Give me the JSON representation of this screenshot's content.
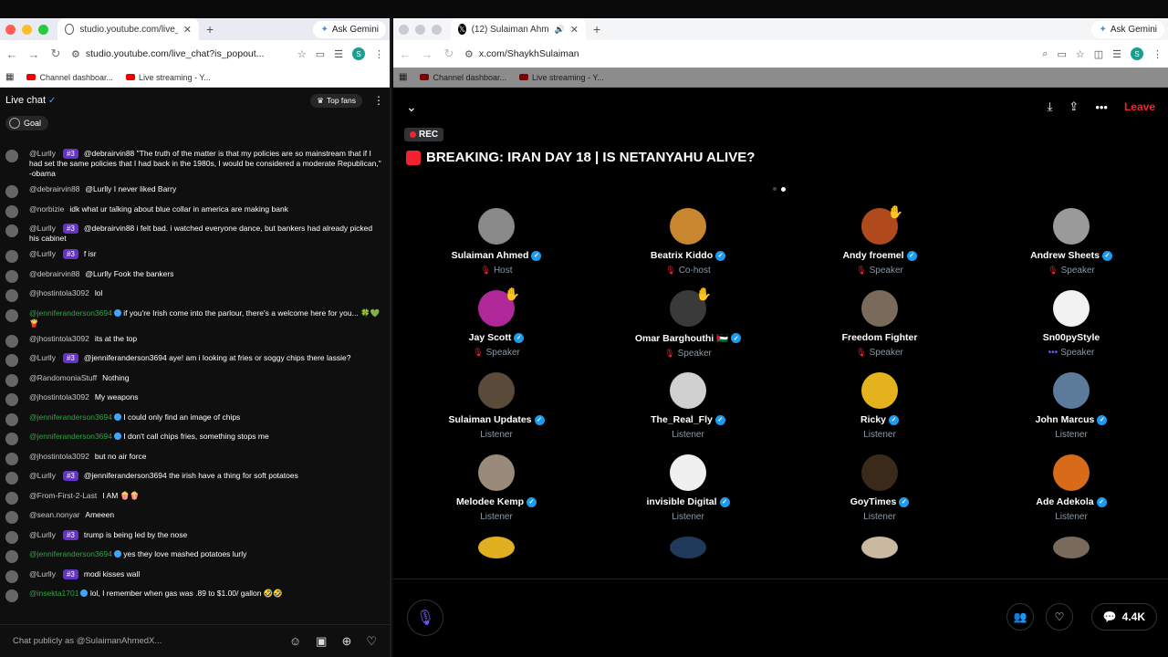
{
  "left_window": {
    "tab_title": "studio.youtube.com/live_chat",
    "ask_gemini": "Ask Gemini",
    "url": "studio.youtube.com/live_chat?is_popout...",
    "bookmarks": [
      "Channel dashboar...",
      "Live streaming - Y..."
    ],
    "chat": {
      "title": "Live chat",
      "top_fans_label": "Top fans",
      "goal_label": "Goal",
      "input_placeholder": "Chat publicly as @SulaimanAhmedX...",
      "messages": [
        {
          "author": "@Lurlly",
          "badge": "#3",
          "text": "@debrairvin88 \"The truth of the matter is that my policies are so mainstream that if I had set the same policies that I had back in the 1980s, I would be considered a moderate Republican,\" -obama"
        },
        {
          "author": "@debrairvin88",
          "badge": "",
          "text": "@Lurlly I never liked Barry"
        },
        {
          "author": "@norbizie",
          "badge": "",
          "text": "idk what ur talking about blue collar in america are making bank"
        },
        {
          "author": "@Lurlly",
          "badge": "#3",
          "text": "@debrairvin88 i felt bad. i watched everyone dance, but bankers had already picked his cabinet"
        },
        {
          "author": "@Lurlly",
          "badge": "#3",
          "text": "f isr"
        },
        {
          "author": "@debrairvin88",
          "badge": "",
          "text": "@Lurlly Fook the bankers"
        },
        {
          "author": "@jhostintola3092",
          "badge": "",
          "text": "lol"
        },
        {
          "author": "@jenniferanderson3694",
          "badge": "",
          "text": "if you're Irish come into the parlour, there's a welcome here for you... 🍀💚🍟",
          "green": true
        },
        {
          "author": "@jhostintola3092",
          "badge": "",
          "text": "its at the top"
        },
        {
          "author": "@Lurlly",
          "badge": "#3",
          "text": "@jenniferanderson3694 aye! am i looking at fries or soggy chips there lassie?"
        },
        {
          "author": "@RandomoniaStuff",
          "badge": "",
          "text": "Nothing"
        },
        {
          "author": "@jhostintola3092",
          "badge": "",
          "text": "My weapons"
        },
        {
          "author": "@jenniferanderson3694",
          "badge": "",
          "text": "I could only find an image of chips",
          "green": true
        },
        {
          "author": "@jenniferanderson3694",
          "badge": "",
          "text": "I don't call chips fries, something stops me",
          "green": true
        },
        {
          "author": "@jhostintola3092",
          "badge": "",
          "text": "but no air force"
        },
        {
          "author": "@Lurlly",
          "badge": "#3",
          "text": "@jenniferanderson3694 the irish have a thing for soft potatoes"
        },
        {
          "author": "@From-First-2-Last",
          "badge": "",
          "text": "I AM 🍿🍿"
        },
        {
          "author": "@sean.nonyar",
          "badge": "",
          "text": "Ameeen"
        },
        {
          "author": "@Lurlly",
          "badge": "#3",
          "text": "trump is being led by the nose"
        },
        {
          "author": "@jenniferanderson3694",
          "badge": "",
          "text": "yes they love mashed potatoes lurly",
          "green": true
        },
        {
          "author": "@Lurlly",
          "badge": "#3",
          "text": "modi kisses wall"
        },
        {
          "author": "@insekta1701",
          "badge": "",
          "text": "lol, I remember when gas was .89 to $1.00/ gallon 🤣🤣",
          "green": true
        }
      ]
    }
  },
  "right_window": {
    "tab_title": "(12) Sulaiman Ahmed (@S",
    "ask_gemini": "Ask Gemini",
    "url": "x.com/ShaykhSulaiman",
    "bookmarks": [
      "Channel dashboar...",
      "Live streaming - Y..."
    ],
    "space": {
      "rec_label": "REC",
      "title": "BREAKING: IRAN DAY 18 | IS NETANYAHU ALIVE?",
      "leave_label": "Leave",
      "listener_count": "4.4K",
      "participants": [
        {
          "name": "Sulaiman Ahmed",
          "role": "Host",
          "verified": true,
          "mic": true,
          "color": "#8a8a8a"
        },
        {
          "name": "Beatrix Kiddo",
          "role": "Co-host",
          "verified": true,
          "mic": true,
          "color": "#c8872e"
        },
        {
          "name": "Andy froemel",
          "role": "Speaker",
          "verified": true,
          "mic": true,
          "color": "#b04a1c",
          "hand": true
        },
        {
          "name": "Andrew Sheets",
          "role": "Speaker",
          "verified": true,
          "mic": true,
          "color": "#9a9a9a"
        },
        {
          "name": "Jay Scott",
          "role": "Speaker",
          "verified": true,
          "mic": true,
          "color": "#b0279a",
          "hand": true
        },
        {
          "name": "Omar Barghouthi 🇵🇸",
          "role": "Speaker",
          "verified": true,
          "mic": true,
          "color": "#3a3a3a",
          "hand": true
        },
        {
          "name": "Freedom Fighter",
          "role": "Speaker",
          "verified": false,
          "mic": true,
          "color": "#7a6a5a"
        },
        {
          "name": "Sn00pyStyle",
          "role": "Speaker",
          "verified": false,
          "mic": false,
          "dots": true,
          "color": "#f2f2f2"
        },
        {
          "name": "Sulaiman Updates",
          "role": "Listener",
          "verified": true,
          "mic": false,
          "color": "#5a4a3a"
        },
        {
          "name": "The_Real_Fly",
          "role": "Listener",
          "verified": true,
          "mic": false,
          "color": "#d0d0d0"
        },
        {
          "name": "Ricky",
          "role": "Listener",
          "verified": true,
          "mic": false,
          "color": "#e3b21c"
        },
        {
          "name": "John Marcus",
          "role": "Listener",
          "verified": true,
          "mic": false,
          "color": "#5c7a9a"
        },
        {
          "name": "Melodee Kemp",
          "role": "Listener",
          "verified": true,
          "mic": false,
          "color": "#9a8a7a"
        },
        {
          "name": "invisible Digital",
          "role": "Listener",
          "verified": true,
          "mic": false,
          "color": "#f0f0f0"
        },
        {
          "name": "GoyTimes",
          "role": "Listener",
          "verified": true,
          "mic": false,
          "color": "#3a2a1a"
        },
        {
          "name": "Ade Adekola",
          "role": "Listener",
          "verified": true,
          "mic": false,
          "color": "#d86a1a"
        }
      ],
      "partial_avatar_colors": [
        "#e0b020",
        "#1f3a5a",
        "#c9b9a0",
        "#7a6a5a"
      ]
    }
  }
}
